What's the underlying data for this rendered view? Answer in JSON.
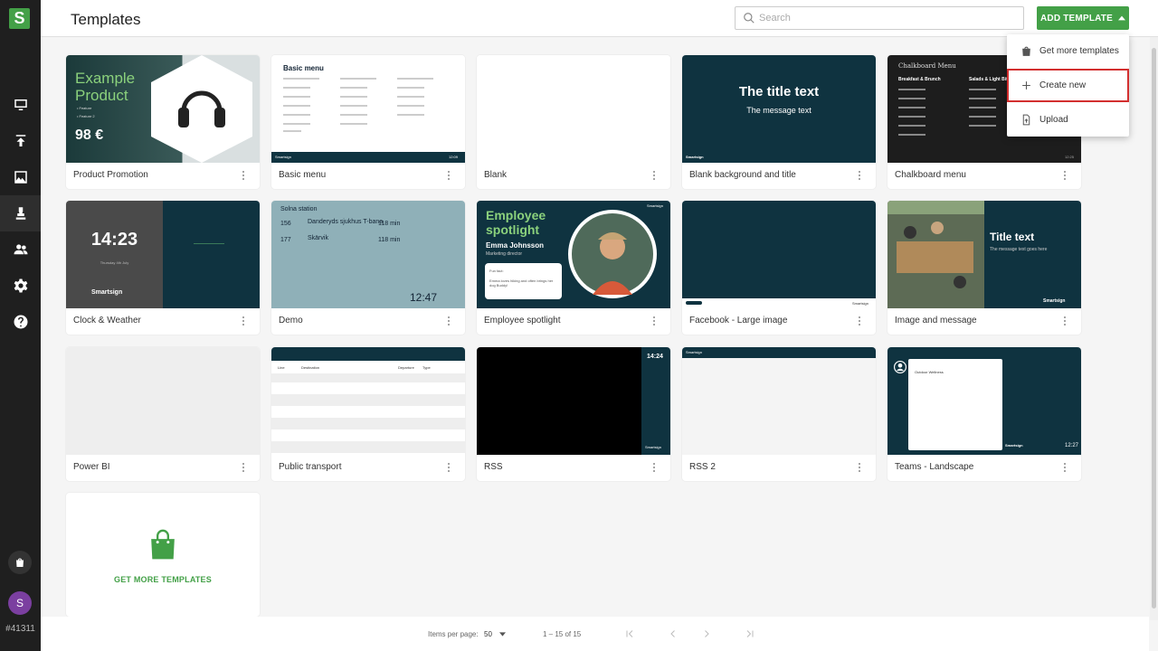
{
  "app": {
    "page_title": "Templates",
    "account_id": "#41311",
    "avatar_initial": "S",
    "logo_letter": "S"
  },
  "sidebar": {
    "items": [
      {
        "icon": "monitor-icon"
      },
      {
        "icon": "upload-icon"
      },
      {
        "icon": "image-icon"
      },
      {
        "icon": "templates-icon"
      },
      {
        "icon": "users-icon"
      },
      {
        "icon": "gear-icon"
      },
      {
        "icon": "help-icon"
      }
    ]
  },
  "header": {
    "search_placeholder": "Search",
    "add_template_label": "ADD TEMPLATE"
  },
  "dropdown": {
    "items": [
      {
        "label": "Get more templates",
        "icon": "shopping-bag-icon"
      },
      {
        "label": "Create new",
        "icon": "plus-icon"
      },
      {
        "label": "Upload",
        "icon": "file-upload-icon"
      }
    ]
  },
  "templates": [
    {
      "name": "Product Promotion"
    },
    {
      "name": "Basic menu"
    },
    {
      "name": "Blank"
    },
    {
      "name": "Blank background and title"
    },
    {
      "name": "Chalkboard menu"
    },
    {
      "name": "Clock & Weather"
    },
    {
      "name": "Demo"
    },
    {
      "name": "Employee spotlight"
    },
    {
      "name": "Facebook - Large image"
    },
    {
      "name": "Image and message"
    },
    {
      "name": "Power BI"
    },
    {
      "name": "Public transport"
    },
    {
      "name": "RSS"
    },
    {
      "name": "RSS 2"
    },
    {
      "name": "Teams - Landscape"
    }
  ],
  "thumbs": {
    "promo_title1": "Example",
    "promo_title2": "Product",
    "promo_feat1": "• Feature",
    "promo_feat2": "• Feature 2",
    "promo_price": "98 €",
    "menu_title": "Basic menu",
    "menu_time": "12:09",
    "bbt_title": "The title text",
    "bbt_msg": "The message text",
    "chalk_title": "Chalkboard Menu",
    "chalk_col1": "Breakfast & Brunch",
    "chalk_col2": "Salads & Light Bites",
    "chalk_time": "12:25",
    "clock_time": "14:23",
    "clock_date": "Thursday 4th July",
    "demo_station": "Solna station",
    "demo_r1_line": "156",
    "demo_r1_dest": "Danderyds sjukhus T-bana",
    "demo_r1_min": "118 min",
    "demo_r2_line": "177",
    "demo_r2_dest": "Skärvik",
    "demo_r2_min": "118 min",
    "demo_time": "12:47",
    "emp_title1": "Employee",
    "emp_title2": "spotlight",
    "emp_name": "Emma Johnsson",
    "emp_role": "Marketing director",
    "emp_fact": "Fun fact:",
    "emp_fact_text": "Emma loves hiking and often brings her dog Buddy!",
    "img_title": "Title text",
    "img_msg": "The message text goes here",
    "rss_time": "14:24",
    "teams_time": "12:27",
    "teams_name": "Outdoor Wellness",
    "transport_cols": [
      "Line",
      "Destination",
      "Departure",
      "Type"
    ],
    "brand": "Smartsign"
  },
  "get_more_label": "GET MORE TEMPLATES",
  "pagination": {
    "items_per_page_label": "Items per page:",
    "items_per_page": "50",
    "range": "1 – 15 of 15"
  }
}
